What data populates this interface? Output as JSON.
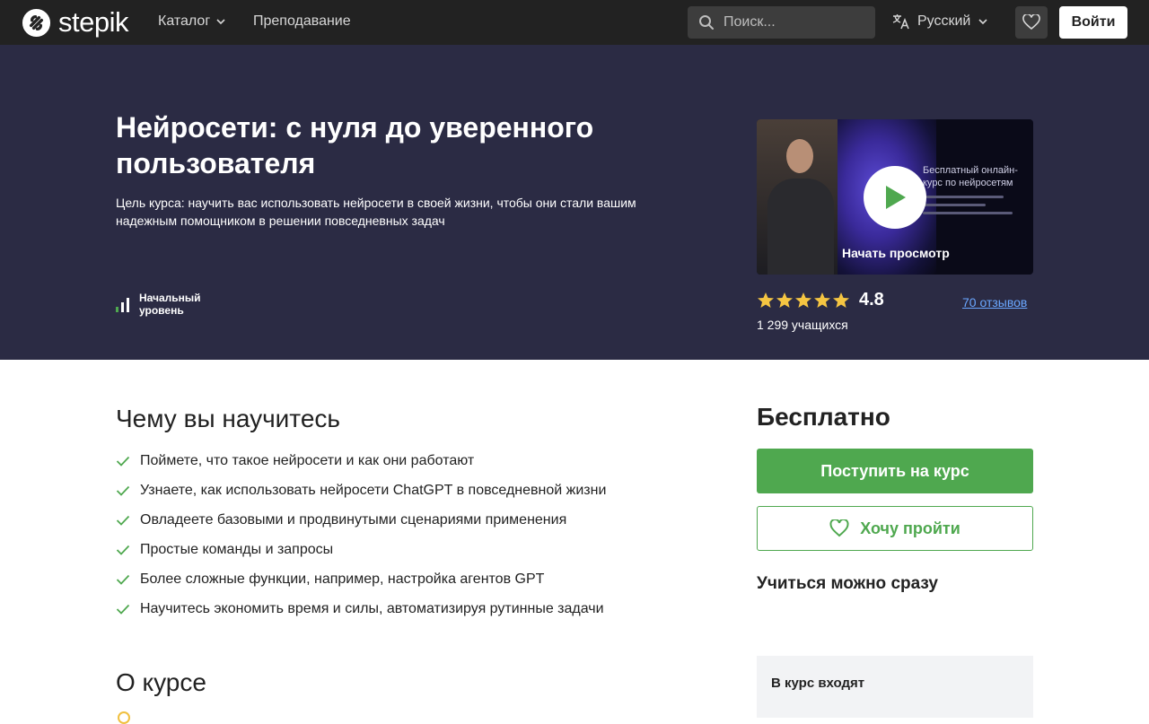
{
  "nav": {
    "logo_text": "stepik",
    "catalog_label": "Каталог",
    "teaching_label": "Преподавание",
    "search_placeholder": "Поиск...",
    "language_label": "Русский",
    "login_label": "Войти"
  },
  "hero": {
    "title": "Нейросети: с нуля до уверенного пользователя",
    "subtitle": "Цель курса: научить вас использовать нейросети в своей жизни, чтобы они стали вашим надежным помощником в решении повседневных задач",
    "level_label": "Начальный уровень",
    "video": {
      "caption": "Начать просмотр",
      "overlay_text": "Бесплатный онлайн-курс по нейросетям"
    },
    "rating_value": "4.8",
    "rating_stars": 5,
    "reviews_label": "70 отзывов",
    "learners_label": "1 299 учащихся"
  },
  "learn": {
    "title": "Чему вы научитесь",
    "items": [
      "Поймете, что такое нейросети и как они работают",
      "Узнаете, как использовать нейросети ChatGPT в повседневной жизни",
      "Овладеете базовыми и продвинутыми сценариями применения",
      "Простые команды и запросы",
      "Более сложные функции, например, настройка агентов GPT",
      "Научитесь экономить время и силы, автоматизируя рутинные задачи"
    ]
  },
  "about": {
    "title": "О курсе"
  },
  "sidebar": {
    "price_label": "Бесплатно",
    "enroll_label": "Поступить на курс",
    "wish_label": "Хочу пройти",
    "learn_now_label": "Учиться можно сразу",
    "includes_title": "В курс входят"
  },
  "colors": {
    "topbar": "#222222",
    "hero_bg": "#2b2b44",
    "accent_green": "#4fa84f",
    "star": "#f5c542",
    "link_blue": "#6aa7ff"
  }
}
